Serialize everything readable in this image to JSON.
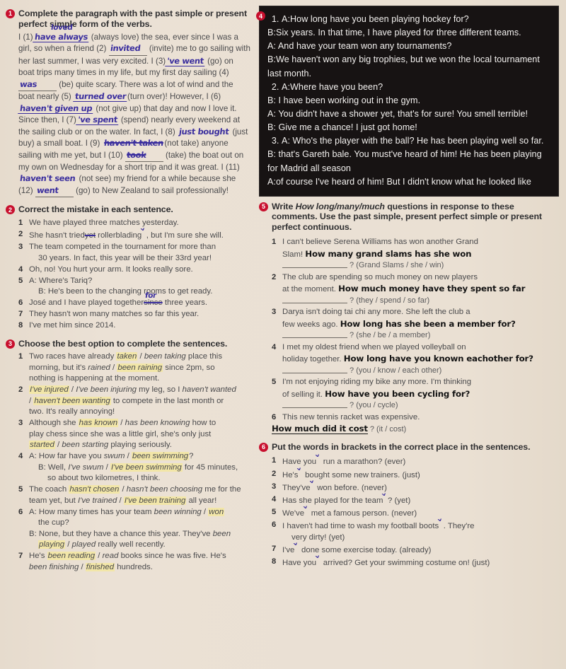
{
  "page": {
    "background_color": "#e9dfd2",
    "badge_color": "#c8102e",
    "handwriting_color": "#3b2f9e",
    "highlight_color": "#f2e6a8",
    "dark_panel_color": "#171313"
  },
  "exercise1": {
    "number": "1",
    "instruction": "Complete the paragraph with the past simple or present perfect simple form of the verbs.",
    "text_segments": [
      "I (1)",
      "(always love) the sea, ever since I was a girl, so when a friend (2)",
      "(invite) me to go sailing with her last summer, I was very excited.",
      "I (3)",
      "(go) on boat trips many times in my life, but my first day sailing (4)",
      "(be) quite scary. There was a lot of wind and the boat nearly (5)",
      "(turn over)! However, I (6)",
      "(not give up) that day and now I love it. Since then, I (7)",
      "(spend) nearly every weekend at the sailing club or on the water. In fact, I (8)",
      "(just buy) a small boat. I (9)",
      "(not take) anyone sailing with me yet, but I (10)",
      "(take) the boat out on my own on Wednesday for a short trip and it was great. I (11)",
      "(not see) my friend for a while because she (12)",
      "(go) to New Zealand to sail professionally!"
    ],
    "handwritten_answers": {
      "1": "have always",
      "1_above": "loved",
      "2": "invited",
      "3": "'ve went",
      "4": "was",
      "5": "turned over",
      "6": "haven't given up",
      "7": "'ve spent",
      "8": "just bought",
      "9": "haven't taken",
      "10": "took",
      "11": "haven't seen",
      "12": "went"
    }
  },
  "exercise2": {
    "number": "2",
    "instruction": "Correct the mistake in each sentence.",
    "items": [
      {
        "num": "1",
        "text": "We have played three matches yesterday."
      },
      {
        "num": "2",
        "pre": "She hasn't tried",
        "struck": "yet",
        "post": "rollerblading",
        "tail": ", but I'm sure she will."
      },
      {
        "num": "3",
        "text": "The team competed in the tournament for more than",
        "line2": "30 years. In fact, this year will be their 33rd year!"
      },
      {
        "num": "4",
        "text": "Oh, no! You hurt your arm. It looks really sore."
      },
      {
        "num": "5",
        "text": "A: Where's Tariq?",
        "sub": "B: He's been to the changing rooms to get ready."
      },
      {
        "num": "6",
        "pre": "José and I have played together",
        "struck": "since",
        "above": "for",
        "post": " three years."
      },
      {
        "num": "7",
        "text": "They hasn't won many matches so far this year."
      },
      {
        "num": "8",
        "text": "I've met him since 2014."
      }
    ]
  },
  "exercise3": {
    "number": "3",
    "instruction": "Choose the best option to complete the sentences.",
    "items": [
      {
        "num": "1",
        "lines": [
          {
            "parts": [
              {
                "t": "Two races have already "
              },
              {
                "t": "taken",
                "i": true,
                "hl": true
              },
              {
                "t": " / "
              },
              {
                "t": "been taking",
                "i": true
              },
              {
                "t": " place this"
              }
            ]
          },
          {
            "parts": [
              {
                "t": "morning, but it's "
              },
              {
                "t": "rained",
                "i": true
              },
              {
                "t": " / "
              },
              {
                "t": "been raining",
                "i": true,
                "hl": true
              },
              {
                "t": " since 2pm, so"
              }
            ]
          },
          {
            "parts": [
              {
                "t": "nothing is happening at the moment."
              }
            ]
          }
        ]
      },
      {
        "num": "2",
        "lines": [
          {
            "parts": [
              {
                "t": "I've injured",
                "i": true,
                "hl": true
              },
              {
                "t": " / "
              },
              {
                "t": "I've been injuring",
                "i": true
              },
              {
                "t": " my leg, so I "
              },
              {
                "t": "haven't wanted",
                "i": true
              }
            ]
          },
          {
            "parts": [
              {
                "t": "/ "
              },
              {
                "t": "haven't been wanting",
                "i": true,
                "hl": true
              },
              {
                "t": " to compete in the last month or"
              }
            ]
          },
          {
            "parts": [
              {
                "t": "two. It's really annoying!"
              }
            ]
          }
        ]
      },
      {
        "num": "3",
        "lines": [
          {
            "parts": [
              {
                "t": "Although she "
              },
              {
                "t": "has known",
                "i": true,
                "hl": true
              },
              {
                "t": " / "
              },
              {
                "t": "has been knowing",
                "i": true
              },
              {
                "t": " how to"
              }
            ]
          },
          {
            "parts": [
              {
                "t": "play chess since she was a little girl, she's only just"
              }
            ]
          },
          {
            "parts": [
              {
                "t": "started",
                "i": true,
                "hl": true
              },
              {
                "t": " / "
              },
              {
                "t": "been starting",
                "i": true
              },
              {
                "t": " playing seriously."
              }
            ]
          }
        ]
      },
      {
        "num": "4",
        "lines": [
          {
            "parts": [
              {
                "t": "A: How far have you "
              },
              {
                "t": "swum",
                "i": true
              },
              {
                "t": " / "
              },
              {
                "t": "been swimming",
                "i": true,
                "hl": true
              },
              {
                "t": "?"
              }
            ]
          },
          {
            "parts": [
              {
                "t": "B: Well, "
              },
              {
                "t": "I've swum",
                "i": true
              },
              {
                "t": " / "
              },
              {
                "t": "I've been swimming",
                "i": true,
                "hl": true
              },
              {
                "t": " for 45 minutes,"
              }
            ],
            "indent": 1
          },
          {
            "parts": [
              {
                "t": "so about two kilometres, I think."
              }
            ],
            "indent": 2
          }
        ]
      },
      {
        "num": "5",
        "lines": [
          {
            "parts": [
              {
                "t": "The coach "
              },
              {
                "t": "hasn't chosen",
                "i": true,
                "hl": true
              },
              {
                "t": " / "
              },
              {
                "t": "hasn't been choosing",
                "i": true
              },
              {
                "t": " me for the"
              }
            ]
          },
          {
            "parts": [
              {
                "t": "team yet, but "
              },
              {
                "t": "I've trained",
                "i": true
              },
              {
                "t": " / "
              },
              {
                "t": "I've been training",
                "i": true,
                "hl": true
              },
              {
                "t": " all year!"
              }
            ]
          }
        ]
      },
      {
        "num": "6",
        "lines": [
          {
            "parts": [
              {
                "t": "A: How many times has your team "
              },
              {
                "t": "been winning",
                "i": true
              },
              {
                "t": " / "
              },
              {
                "t": "won",
                "i": true,
                "hl": true
              }
            ]
          },
          {
            "parts": [
              {
                "t": "the cup?"
              }
            ],
            "indent": 1
          },
          {
            "parts": [
              {
                "t": "B: None, but they have a chance this year. They've "
              },
              {
                "t": "been",
                "i": true
              }
            ]
          },
          {
            "parts": [
              {
                "t": "playing",
                "i": true,
                "hl": true
              },
              {
                "t": " / "
              },
              {
                "t": "played",
                "i": true
              },
              {
                "t": " really well recently."
              }
            ],
            "indent": 1
          }
        ]
      },
      {
        "num": "7",
        "lines": [
          {
            "parts": [
              {
                "t": "He's "
              },
              {
                "t": "been reading",
                "i": true,
                "hl": true
              },
              {
                "t": " / "
              },
              {
                "t": "read",
                "i": true
              },
              {
                "t": " books since he was five. He's"
              }
            ]
          },
          {
            "parts": [
              {
                "t": "been finishing",
                "i": true
              },
              {
                "t": " / "
              },
              {
                "t": "finished",
                "i": true,
                "hl": true
              },
              {
                "t": " hundreds."
              }
            ]
          }
        ]
      }
    ]
  },
  "exercise4": {
    "number": "4",
    "dialogues": [
      {
        "num": "1",
        "opening": "A:How long have you been playing hockey for?",
        "lines": [
          "B:Six years. In that time, I have played for three different teams.",
          "A: And have your team won any tournaments?",
          "B:We haven't won any big trophies, but we won the local tournament last month."
        ]
      },
      {
        "num": "2",
        "opening": "A:Where have you been?",
        "lines": [
          "B: I have been working out in the gym.",
          "A: You didn't have a shower yet, that's for sure! You smell terrible!",
          "B: Give me a chance! I just got home!"
        ]
      },
      {
        "num": "3",
        "opening": "A: Who's the player with the ball? He has been playing well so far.",
        "lines": [
          "B: that's Gareth bale. You must've heard of him! He has been playing for Madrid all season",
          "A:of course I've heard of him! But I didn't know what he looked like"
        ]
      }
    ]
  },
  "exercise5": {
    "number": "5",
    "instruction": "Write How long/many/much questions in response to these comments. Use the past simple, present perfect simple or present perfect continuous.",
    "instruction_italic": "How long/many/much",
    "items": [
      {
        "num": "1",
        "comment1": "I can't believe Serena Williams has won another Grand",
        "comment2": "Slam!",
        "answer": "How many grand slams has she won",
        "prompt": "? (Grand Slams / she / win)"
      },
      {
        "num": "2",
        "comment1": "The club are spending so much money on new players",
        "comment2": "at the moment.",
        "answer": "How much money have they spent so far",
        "prompt": "? (they / spend / so far)"
      },
      {
        "num": "3",
        "comment1": "Darya isn't doing tai chi any more. She left the club a",
        "comment2": "few weeks ago.",
        "answer": "How long has she been a member for?",
        "prompt": "? (she / be / a member)"
      },
      {
        "num": "4",
        "comment1": "I met my oldest friend when we played volleyball on",
        "comment2": "holiday together.",
        "answer": "How long  have you known eachother for?",
        "prompt": "? (you / know / each other)"
      },
      {
        "num": "5",
        "comment1": "I'm not enjoying riding my bike any more. I'm thinking",
        "comment2": "of selling it.",
        "answer": "How have you been cycling for?",
        "prompt": "? (you / cycle)"
      },
      {
        "num": "6",
        "comment1": "This new tennis racket was expensive.",
        "comment2": "",
        "answer": "How much did it cost",
        "prompt": "? (it / cost)",
        "answer_inline": true
      }
    ]
  },
  "exercise6": {
    "number": "6",
    "instruction": "Put the words in brackets in the correct place in the sentences.",
    "items": [
      {
        "num": "1",
        "pre": "Have you",
        "post": " run a marathon? (ever)"
      },
      {
        "num": "2",
        "pre": "He's",
        "post": " bought some new trainers. (just)"
      },
      {
        "num": "3",
        "pre": "They've",
        "post": " won before. (never)"
      },
      {
        "num": "4",
        "pre": "Has she played for the team",
        "post": "? (yet)"
      },
      {
        "num": "5",
        "pre": "We've",
        "post": " met a famous person. (never)"
      },
      {
        "num": "6",
        "pre": "I haven't had time to wash my football boots",
        "post": ". They're",
        "line2": "very dirty! (yet)"
      },
      {
        "num": "7",
        "pre": "I've",
        "post": " done some exercise today. (already)"
      },
      {
        "num": "8",
        "pre": "Have you",
        "post": " arrived? Get your swimming costume on! (just)"
      }
    ]
  }
}
